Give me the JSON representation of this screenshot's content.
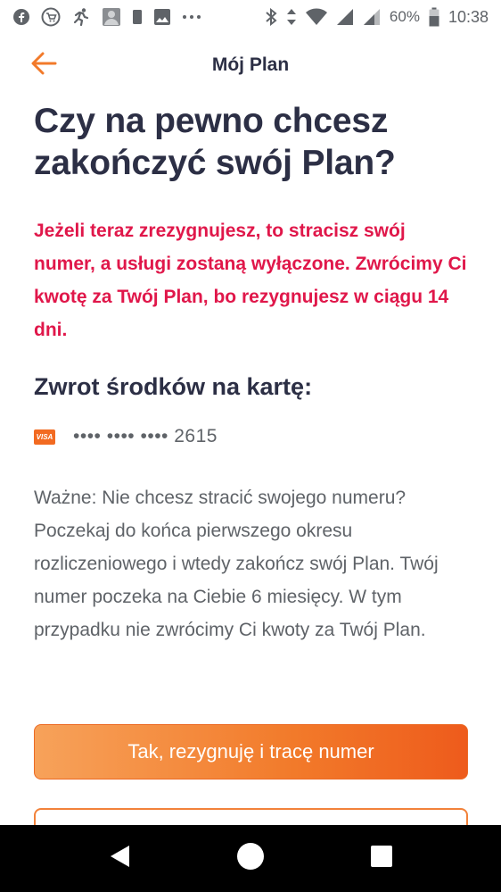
{
  "status_bar": {
    "left_icons": [
      "facebook-icon",
      "shopping-cart-icon",
      "running-icon",
      "photo-avatar-icon",
      "sim-icon",
      "gallery-icon",
      "more-icon"
    ],
    "right_icons": [
      "bluetooth-icon",
      "data-arrows-icon",
      "wifi-icon",
      "signal-icon",
      "signal-icon-2",
      "battery-icon"
    ],
    "battery": "60%",
    "time": "10:38"
  },
  "header": {
    "title": "Mój Plan",
    "back_icon": "arrow-left-icon"
  },
  "main": {
    "title": "Czy na pewno chcesz zakończyć swój Plan?",
    "warning": "Jeżeli teraz zrezygnujesz, to stracisz swój numer, a usługi zostaną wyłączone. Zwrócimy Ci kwotę za Twój Plan, bo rezygnujesz w ciągu 14 dni.",
    "refund_title": "Zwrot środków na kartę:",
    "card_brand": "VISA",
    "card_number": "•••• •••• •••• 2615",
    "info": "Ważne: Nie chcesz stracić swojego numeru? Poczekaj do końca pierwszego okresu rozliczeniowego i wtedy zakończ swój Plan. Twój numer poczeka na Ciebie 6 miesięcy. W tym przypadku nie zwrócimy Ci kwoty za Twój Plan.",
    "primary_button": "Tak, rezygnuję i tracę numer"
  },
  "colors": {
    "accent": "#f27a2a",
    "warning": "#e0174a",
    "title": "#2c2f45",
    "body": "#5f6368"
  },
  "nav_bar": {
    "icons": [
      "back-triangle-icon",
      "home-circle-icon",
      "recents-square-icon"
    ]
  }
}
